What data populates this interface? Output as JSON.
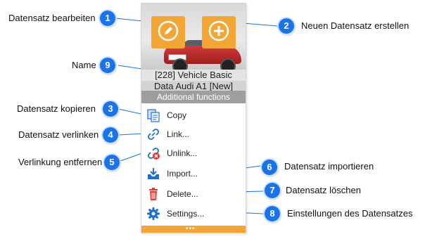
{
  "panel": {
    "record_title_line1": "[228] Vehicle Basic",
    "record_title_line2": "Data Audi A1 [New]",
    "section_label": "Additional functions",
    "footer_dots": "•••",
    "menu": [
      {
        "label": "Copy",
        "icon": "copy-icon"
      },
      {
        "label": "Link...",
        "icon": "link-icon"
      },
      {
        "label": "Unlink...",
        "icon": "unlink-icon"
      },
      {
        "label": "Import...",
        "icon": "import-icon"
      },
      {
        "label": "Delete...",
        "icon": "trash-icon"
      },
      {
        "label": "Settings...",
        "icon": "gear-icon"
      }
    ]
  },
  "callouts": [
    {
      "number": "1",
      "text": "Datensatz bearbeiten"
    },
    {
      "number": "2",
      "text": "Neuen Datensatz erstellen"
    },
    {
      "number": "3",
      "text": "Datensatz kopieren"
    },
    {
      "number": "4",
      "text": "Datensatz verlinken"
    },
    {
      "number": "5",
      "text": "Verlinkung entfernen"
    },
    {
      "number": "6",
      "text": "Datensatz importieren"
    },
    {
      "number": "7",
      "text": "Datensatz löschen"
    },
    {
      "number": "8",
      "text": "Einstellungen des Datensatzes"
    },
    {
      "number": "9",
      "text": "Name"
    }
  ],
  "colors": {
    "accent_orange": "#f3a535",
    "badge_blue": "#1a73e8",
    "section_gray": "#9e9e9e",
    "delete_red": "#e53935",
    "icon_blue": "#1f6fd1"
  }
}
